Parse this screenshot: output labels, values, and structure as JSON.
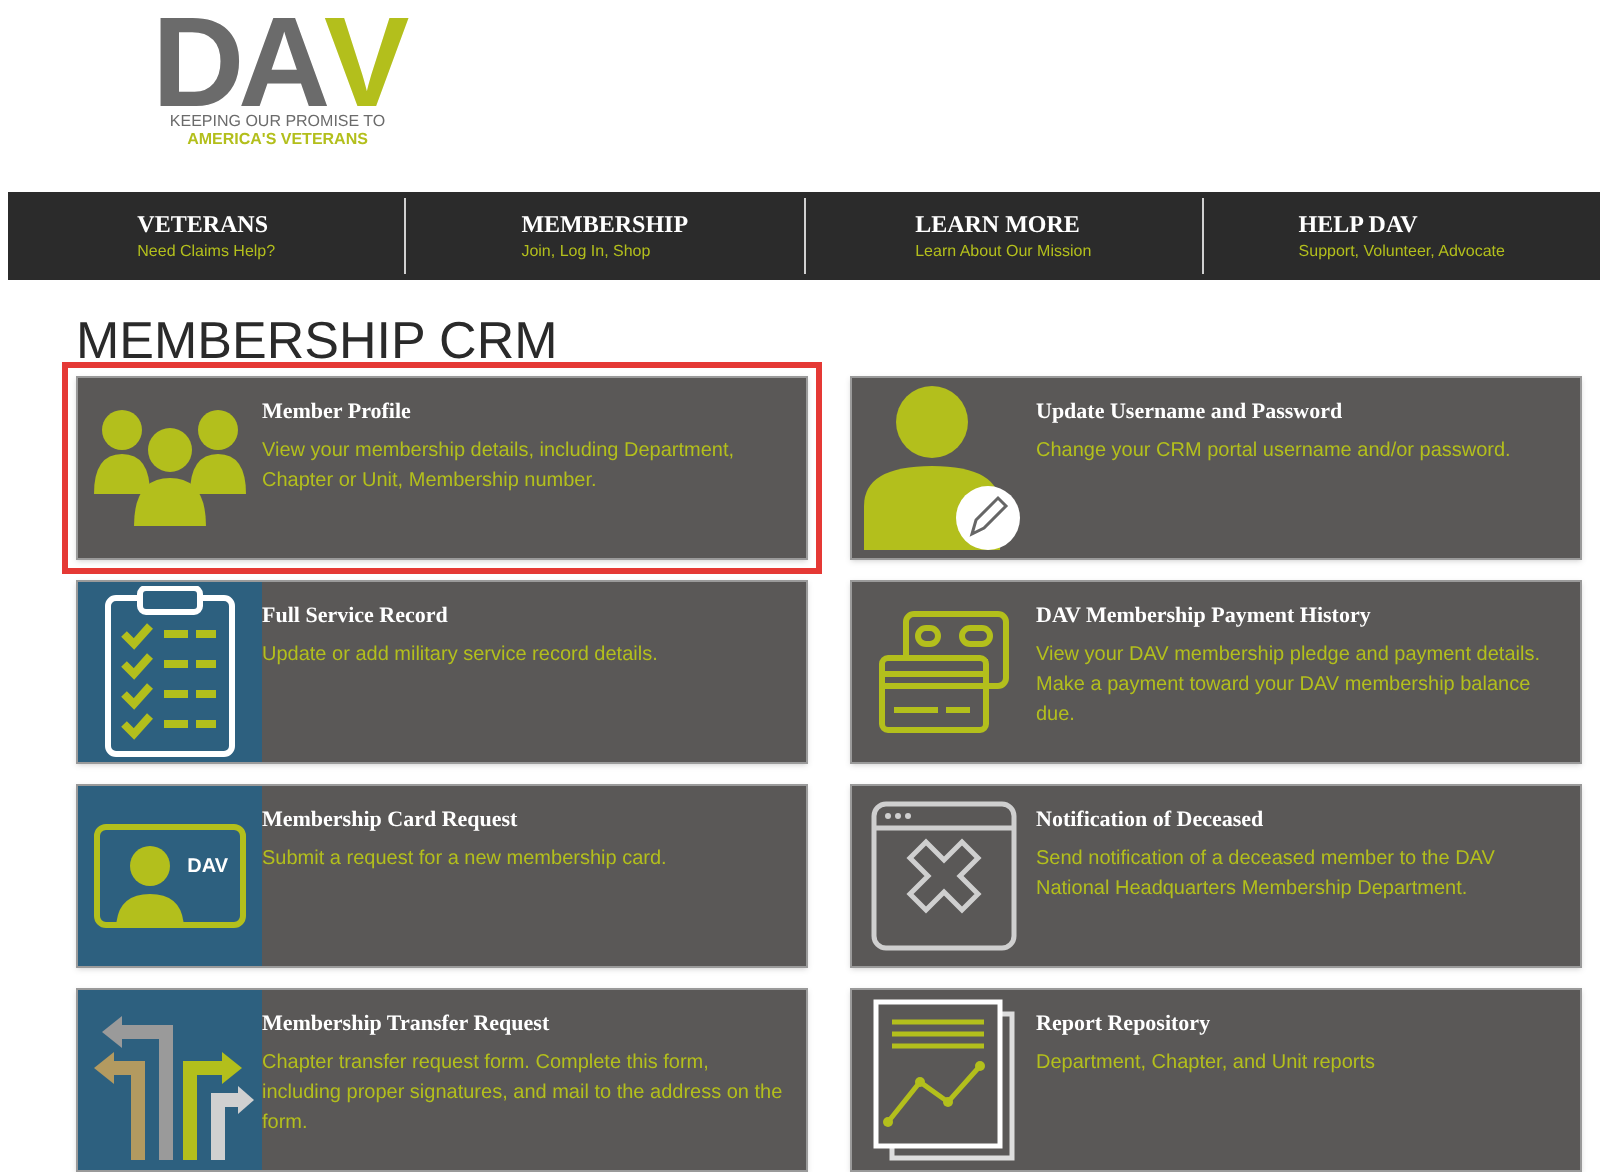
{
  "logo": {
    "letters": [
      {
        "text": "DA",
        "color": "#6b6b6b"
      },
      {
        "text": "V",
        "color": "#b3bf1c"
      }
    ],
    "tagline": [
      "KEEPING OUR PROMISE TO",
      "AMERICA'S VETERANS"
    ]
  },
  "nav": [
    {
      "title": "VETERANS",
      "subtitle": "Need Claims Help?"
    },
    {
      "title": "MEMBERSHIP",
      "subtitle": "Join, Log In, Shop"
    },
    {
      "title": "LEARN MORE",
      "subtitle": "Learn About Our Mission"
    },
    {
      "title": "HELP DAV",
      "subtitle": "Support, Volunteer, Advocate"
    }
  ],
  "heading": "MEMBERSHIP CRM",
  "cards": [
    {
      "title": "Member Profile",
      "description": "View your membership details, including Department, Chapter or Unit, Membership number.",
      "kind": "people",
      "color": "#5a5857",
      "highlighted": true
    },
    {
      "title": "Update Username and Password",
      "description": "Change your CRM portal username and/or password.",
      "kind": "user-edit",
      "color": "#5a5857",
      "highlighted": false
    },
    {
      "title": "Full Service Record",
      "description": "Update or add military service record details.",
      "kind": "checklist",
      "color": "#2d607f",
      "highlighted": false
    },
    {
      "title": "DAV Membership Payment History",
      "description": "View your DAV membership pledge and payment details. Make a payment toward your DAV membership balance due.",
      "kind": "cards",
      "color": "#5a5857",
      "highlighted": false
    },
    {
      "title": "Membership Card Request",
      "description": "Submit a request for a new membership card.",
      "kind": "id-card",
      "card_label": "DAV",
      "color": "#2d607f",
      "highlighted": false
    },
    {
      "title": "Notification of Deceased",
      "description": "Send notification of a deceased member to the DAV National Headquarters Membership Department.",
      "kind": "window-x",
      "color": "#5a5857",
      "highlighted": false
    },
    {
      "title": "Membership Transfer Request",
      "description": "Chapter transfer request form. Complete this form, including proper signatures, and mail to the address on the form.",
      "kind": "arrows",
      "color": "#2d607f",
      "highlighted": false
    },
    {
      "title": "Report Repository",
      "description": "Department, Chapter, and Unit reports",
      "kind": "report",
      "color": "#5a5857",
      "highlighted": false
    }
  ]
}
